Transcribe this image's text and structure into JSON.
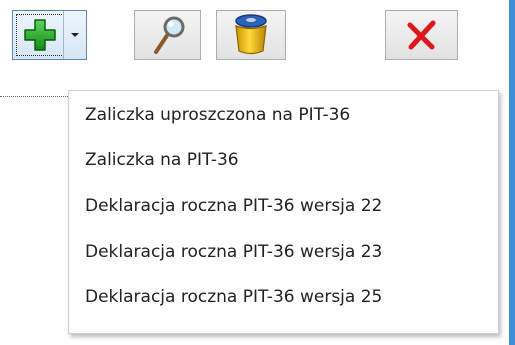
{
  "toolbar": {
    "buttons": [
      {
        "icon": "plus-icon",
        "color": "#1fa51f"
      },
      {
        "icon": "chevron-down-icon"
      },
      {
        "icon": "magnifier-icon"
      },
      {
        "icon": "trash-bin-icon",
        "color": "#f1c400"
      },
      {
        "icon": "close-icon",
        "color": "#e0161e"
      }
    ]
  },
  "dropdown": {
    "items": [
      {
        "label": "Zaliczka uproszczona na PIT-36"
      },
      {
        "label": "Zaliczka na PIT-36"
      },
      {
        "label": "Deklaracja roczna PIT-36 wersja 22"
      },
      {
        "label": "Deklaracja roczna PIT-36 wersja 23"
      },
      {
        "label": "Deklaracja roczna PIT-36 wersja 25"
      }
    ]
  },
  "colors": {
    "window_edge": "#3d8fd6",
    "menu_text": "#222222"
  }
}
